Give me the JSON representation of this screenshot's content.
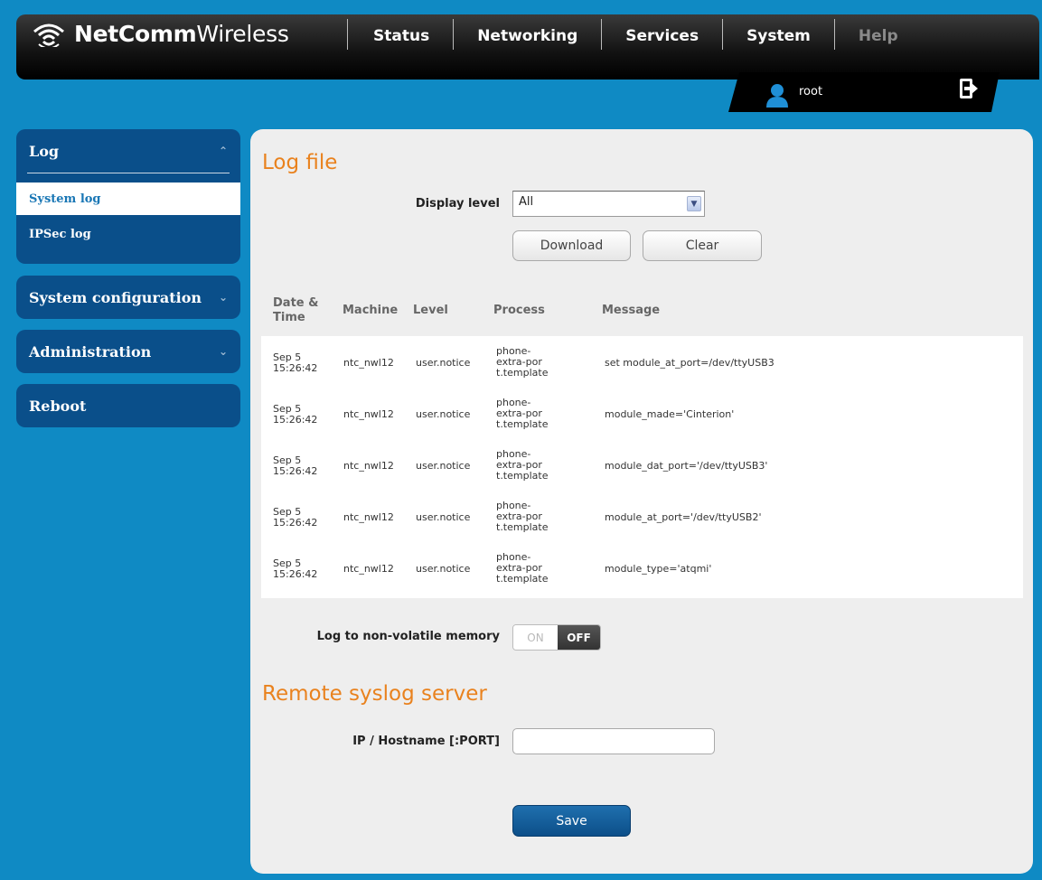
{
  "brand": {
    "bold": "NetComm",
    "light": "Wireless"
  },
  "nav": [
    {
      "label": "Status"
    },
    {
      "label": "Networking"
    },
    {
      "label": "Services"
    },
    {
      "label": "System"
    },
    {
      "label": "Help"
    }
  ],
  "user": {
    "name": "root"
  },
  "sidebar": {
    "log": {
      "title": "Log",
      "items": [
        {
          "label": "System log"
        },
        {
          "label": "IPSec log"
        }
      ]
    },
    "system_configuration": {
      "title": "System configuration"
    },
    "administration": {
      "title": "Administration"
    },
    "reboot": {
      "title": "Reboot"
    }
  },
  "log_file": {
    "title": "Log file",
    "display_level_label": "Display level",
    "display_level_value": "All",
    "download_label": "Download",
    "clear_label": "Clear"
  },
  "table": {
    "columns": [
      "Date & Time",
      "Machine",
      "Level",
      "Process",
      "Message"
    ],
    "rows": [
      {
        "date": "Sep 5",
        "time": "15:26:42",
        "machine": "ntc_nwl12",
        "level": "user.notice",
        "process": [
          "phone-",
          "extra-por",
          "t.template"
        ],
        "message": "set module_at_port=/dev/ttyUSB3"
      },
      {
        "date": "Sep 5",
        "time": "15:26:42",
        "machine": "ntc_nwl12",
        "level": "user.notice",
        "process": [
          "phone-",
          "extra-por",
          "t.template"
        ],
        "message": "module_made='Cinterion'"
      },
      {
        "date": "Sep 5",
        "time": "15:26:42",
        "machine": "ntc_nwl12",
        "level": "user.notice",
        "process": [
          "phone-",
          "extra-por",
          "t.template"
        ],
        "message": "module_dat_port='/dev/ttyUSB3'"
      },
      {
        "date": "Sep 5",
        "time": "15:26:42",
        "machine": "ntc_nwl12",
        "level": "user.notice",
        "process": [
          "phone-",
          "extra-por",
          "t.template"
        ],
        "message": "module_at_port='/dev/ttyUSB2'"
      },
      {
        "date": "Sep 5",
        "time": "15:26:42",
        "machine": "ntc_nwl12",
        "level": "user.notice",
        "process": [
          "phone-",
          "extra-por",
          "t.template"
        ],
        "message": "module_type='atqmi'"
      }
    ]
  },
  "nonvolatile": {
    "label": "Log to non-volatile memory",
    "on_label": "ON",
    "off_label": "OFF"
  },
  "remote": {
    "title": "Remote syslog server",
    "ip_label": "IP / Hostname [:PORT]",
    "ip_value": "",
    "save_label": "Save"
  },
  "colors": {
    "background": "#0f8ac4",
    "accent_orange": "#e9821e",
    "sidebar": "#0a4f8a",
    "button_blue": "#0c4f89"
  }
}
